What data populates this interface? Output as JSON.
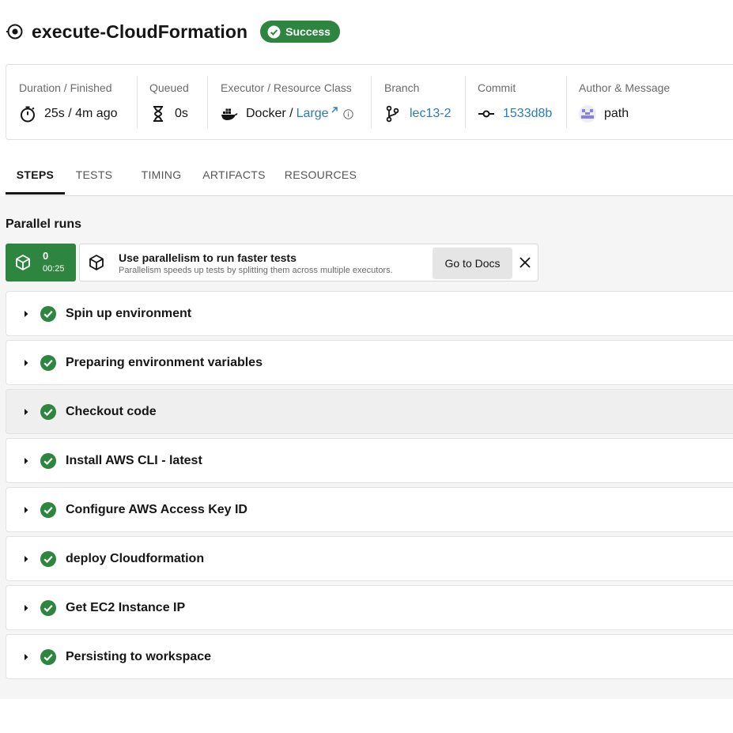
{
  "job": {
    "title": "execute-CloudFormation",
    "status": "Success",
    "icon": "job-circle-icon"
  },
  "meta": {
    "duration": {
      "label": "Duration / Finished",
      "value": "25s / 4m ago",
      "icon": "stopwatch-icon"
    },
    "queued": {
      "label": "Queued",
      "value": "0s",
      "icon": "hourglass-icon"
    },
    "executor": {
      "label": "Executor / Resource Class",
      "value": "Docker /",
      "resource_class": "Large",
      "icon": "docker-icon"
    },
    "branch": {
      "label": "Branch",
      "value": "lec13-2",
      "icon": "git-branch-icon"
    },
    "commit": {
      "label": "Commit",
      "value": "1533d8b",
      "icon": "git-commit-icon"
    },
    "author": {
      "label": "Author & Message",
      "value": "path",
      "icon": "avatar"
    }
  },
  "tabs": [
    "STEPS",
    "TESTS",
    "TIMING",
    "ARTIFACTS",
    "RESOURCES"
  ],
  "active_tab": "STEPS",
  "parallel": {
    "title": "Parallel runs",
    "run_index": "0",
    "run_time": "00:25",
    "promo_title": "Use parallelism to run faster tests",
    "promo_subtitle": "Parallelism speeds up tests by splitting them across multiple executors.",
    "docs_button": "Go to Docs"
  },
  "steps": [
    "Spin up environment",
    "Preparing environment variables",
    "Checkout code",
    "Install AWS CLI - latest",
    "Configure AWS Access Key ID",
    "deploy Cloudformation",
    "Get EC2 Instance IP",
    "Persisting to workspace"
  ],
  "colors": {
    "success": "#2e8540",
    "link": "#2b7bb9"
  }
}
